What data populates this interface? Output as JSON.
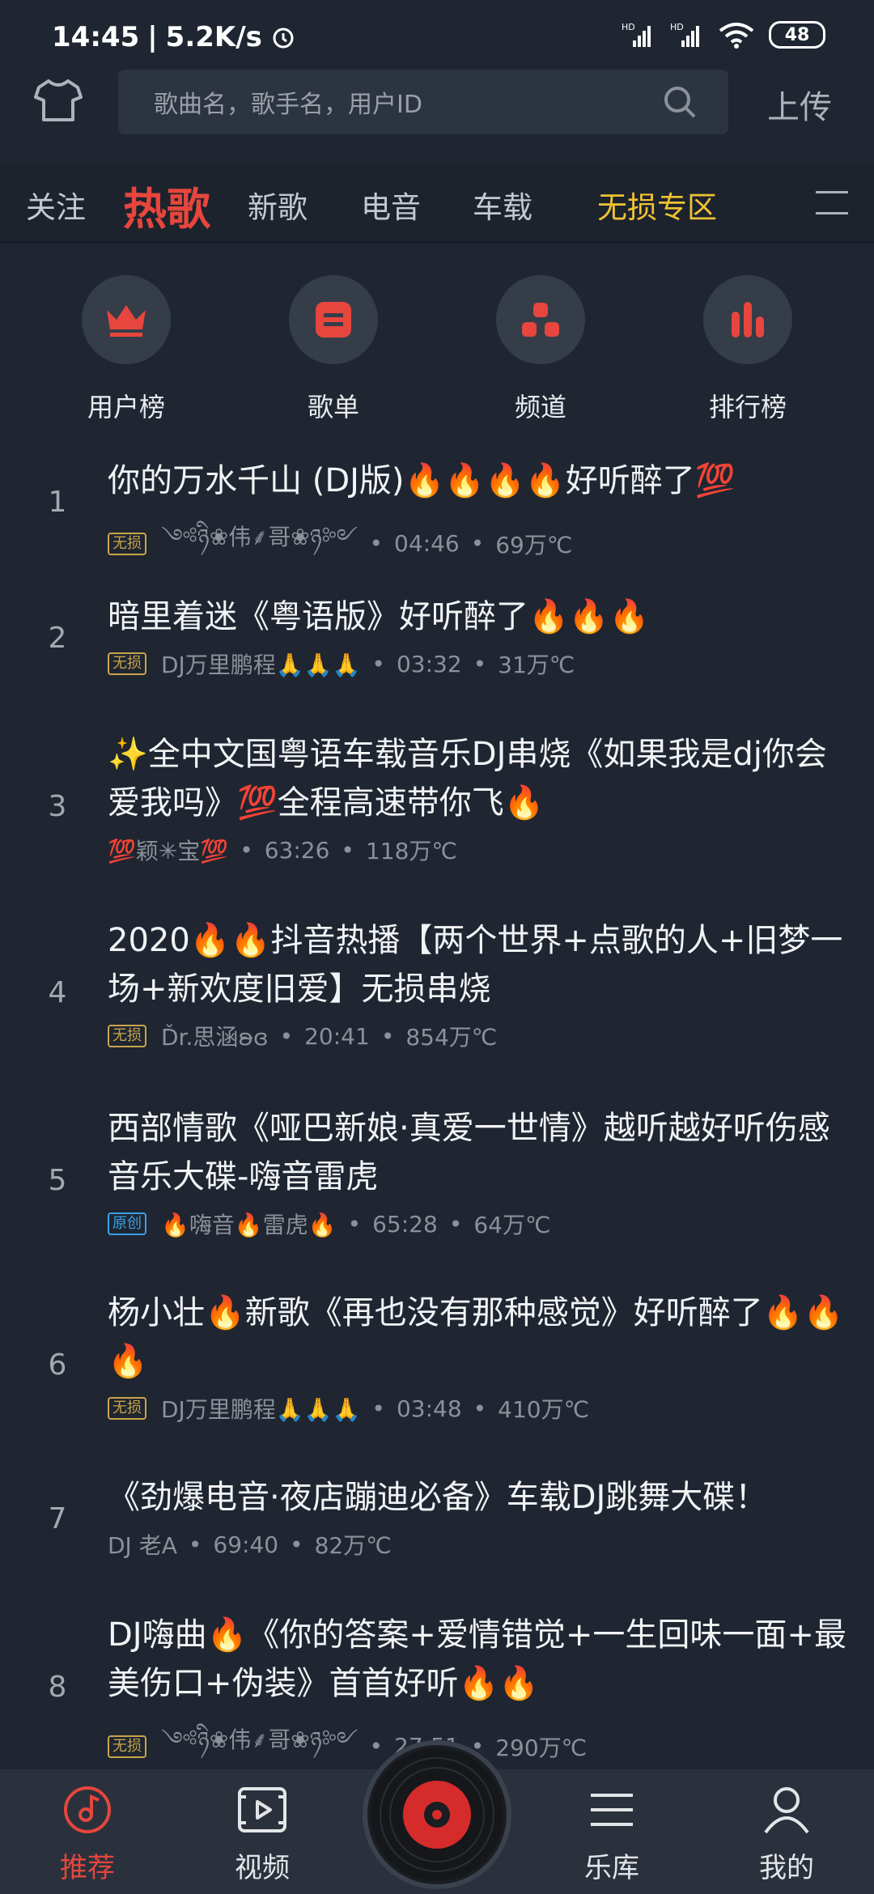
{
  "status": {
    "time": "14:45",
    "speed": "5.2K/s",
    "battery": "48"
  },
  "header": {
    "search_placeholder": "歌曲名，歌手名，用户ID",
    "upload": "上传"
  },
  "tabs": [
    {
      "label": "关注"
    },
    {
      "label": "热歌"
    },
    {
      "label": "新歌"
    },
    {
      "label": "电音"
    },
    {
      "label": "车载"
    },
    {
      "label": "无损专区"
    }
  ],
  "quick": [
    {
      "label": "用户榜",
      "icon": "crown-icon"
    },
    {
      "label": "歌单",
      "icon": "playlist-icon"
    },
    {
      "label": "频道",
      "icon": "channel-icon"
    },
    {
      "label": "排行榜",
      "icon": "chart-icon"
    }
  ],
  "songs": [
    {
      "rank": "1",
      "title": "你的万水千山 (DJ版)🔥🔥🔥🔥好听醉了💯",
      "badge": "无损",
      "artist": "༺ཉི❀伟⸙哥❀ཉ༻",
      "duration": "04:46",
      "plays": "69万℃"
    },
    {
      "rank": "2",
      "title": "暗里着迷《粤语版》好听醉了🔥🔥🔥",
      "badge": "无损",
      "artist": "DJ万里鹏程🙏🙏🙏",
      "duration": "03:32",
      "plays": "31万℃"
    },
    {
      "rank": "3",
      "title": "✨全中文国粤语车载音乐DJ串烧《如果我是dj你会爱我吗》💯全程高速带你飞🔥",
      "badge": "",
      "artist": "💯颖✳宝💯",
      "duration": "63:26",
      "plays": "118万℃"
    },
    {
      "rank": "4",
      "title": "2020🔥🔥抖音热播【两个世界+点歌的人+旧梦一场+新欢度旧爱】无损串烧",
      "badge": "无损",
      "artist": "Ďr.思涵ʚ̴ɞ",
      "duration": "20:41",
      "plays": "854万℃"
    },
    {
      "rank": "5",
      "title": "西部情歌《哑巴新娘·真爱一世情》越听越好听伤感音乐大碟-嗨音雷虎",
      "badge": "原创",
      "artist": "🔥嗨音🔥雷虎🔥",
      "duration": "65:28",
      "plays": "64万℃"
    },
    {
      "rank": "6",
      "title": "杨小壮🔥新歌《再也没有那种感觉》好听醉了🔥🔥🔥",
      "badge": "无损",
      "artist": "DJ万里鹏程🙏🙏🙏",
      "duration": "03:48",
      "plays": "410万℃"
    },
    {
      "rank": "7",
      "title": "《劲爆电音·夜店蹦迪必备》车载DJ跳舞大碟！",
      "badge": "",
      "artist": "DJ 老A",
      "duration": "69:40",
      "plays": "82万℃"
    },
    {
      "rank": "8",
      "title": "DJ嗨曲🔥《你的答案+爱情错觉+一生回味一面+最美伤口+伪装》首首好听🔥🔥",
      "badge": "无损",
      "artist": "༺ཉི❀伟⸙哥❀ཉ༻",
      "duration": "27:51",
      "plays": "290万℃"
    }
  ],
  "nav": [
    {
      "label": "推荐"
    },
    {
      "label": "视频"
    },
    {
      "label": "乐库"
    },
    {
      "label": "我的"
    }
  ],
  "colors": {
    "accent": "#e6463d",
    "gold": "#f1c232",
    "background": "#1f2631"
  }
}
